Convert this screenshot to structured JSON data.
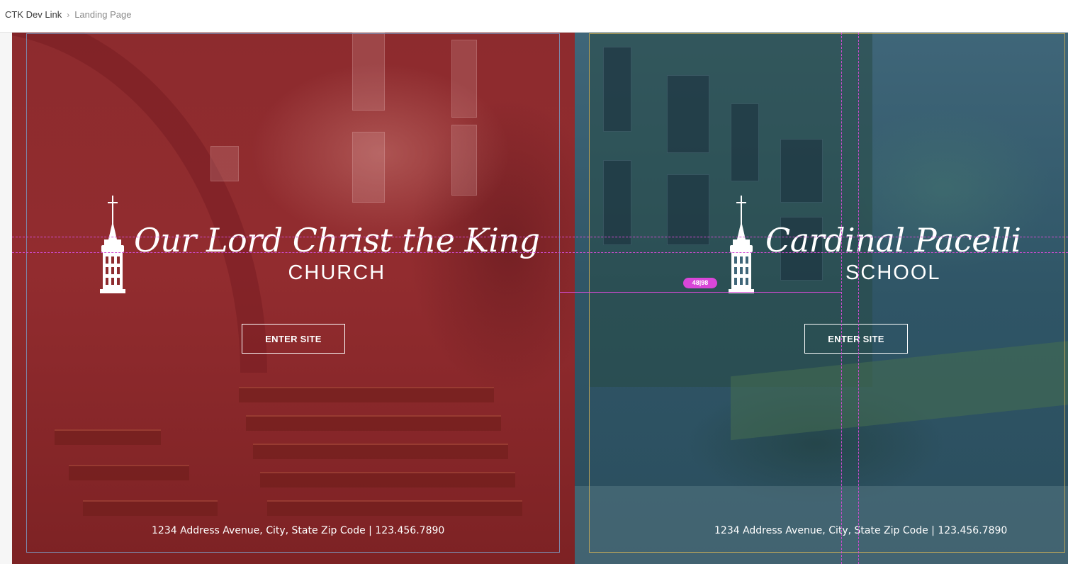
{
  "breadcrumb": {
    "root": "CTK Dev Link",
    "separator_icon": "chevron-right-icon",
    "current": "Landing Page"
  },
  "church": {
    "title": "Our Lord Christ the King",
    "subtitle": "CHURCH",
    "button_label": "ENTER SITE",
    "address": "1234 Address Avenue, City, State Zip Code | 123.456.7890",
    "overlay_color": "#8d2b2e",
    "icon": "bell-tower-icon"
  },
  "school": {
    "title": "Cardinal Pacelli",
    "subtitle": "SCHOOL",
    "button_label": "ENTER SITE",
    "address": "1234 Address Avenue, City, State Zip Code | 123.456.7890",
    "overlay_color": "#3f6679",
    "icon": "bell-tower-icon"
  },
  "editor": {
    "measurement_label": "48|98",
    "guide_color": "#d24bd4"
  }
}
